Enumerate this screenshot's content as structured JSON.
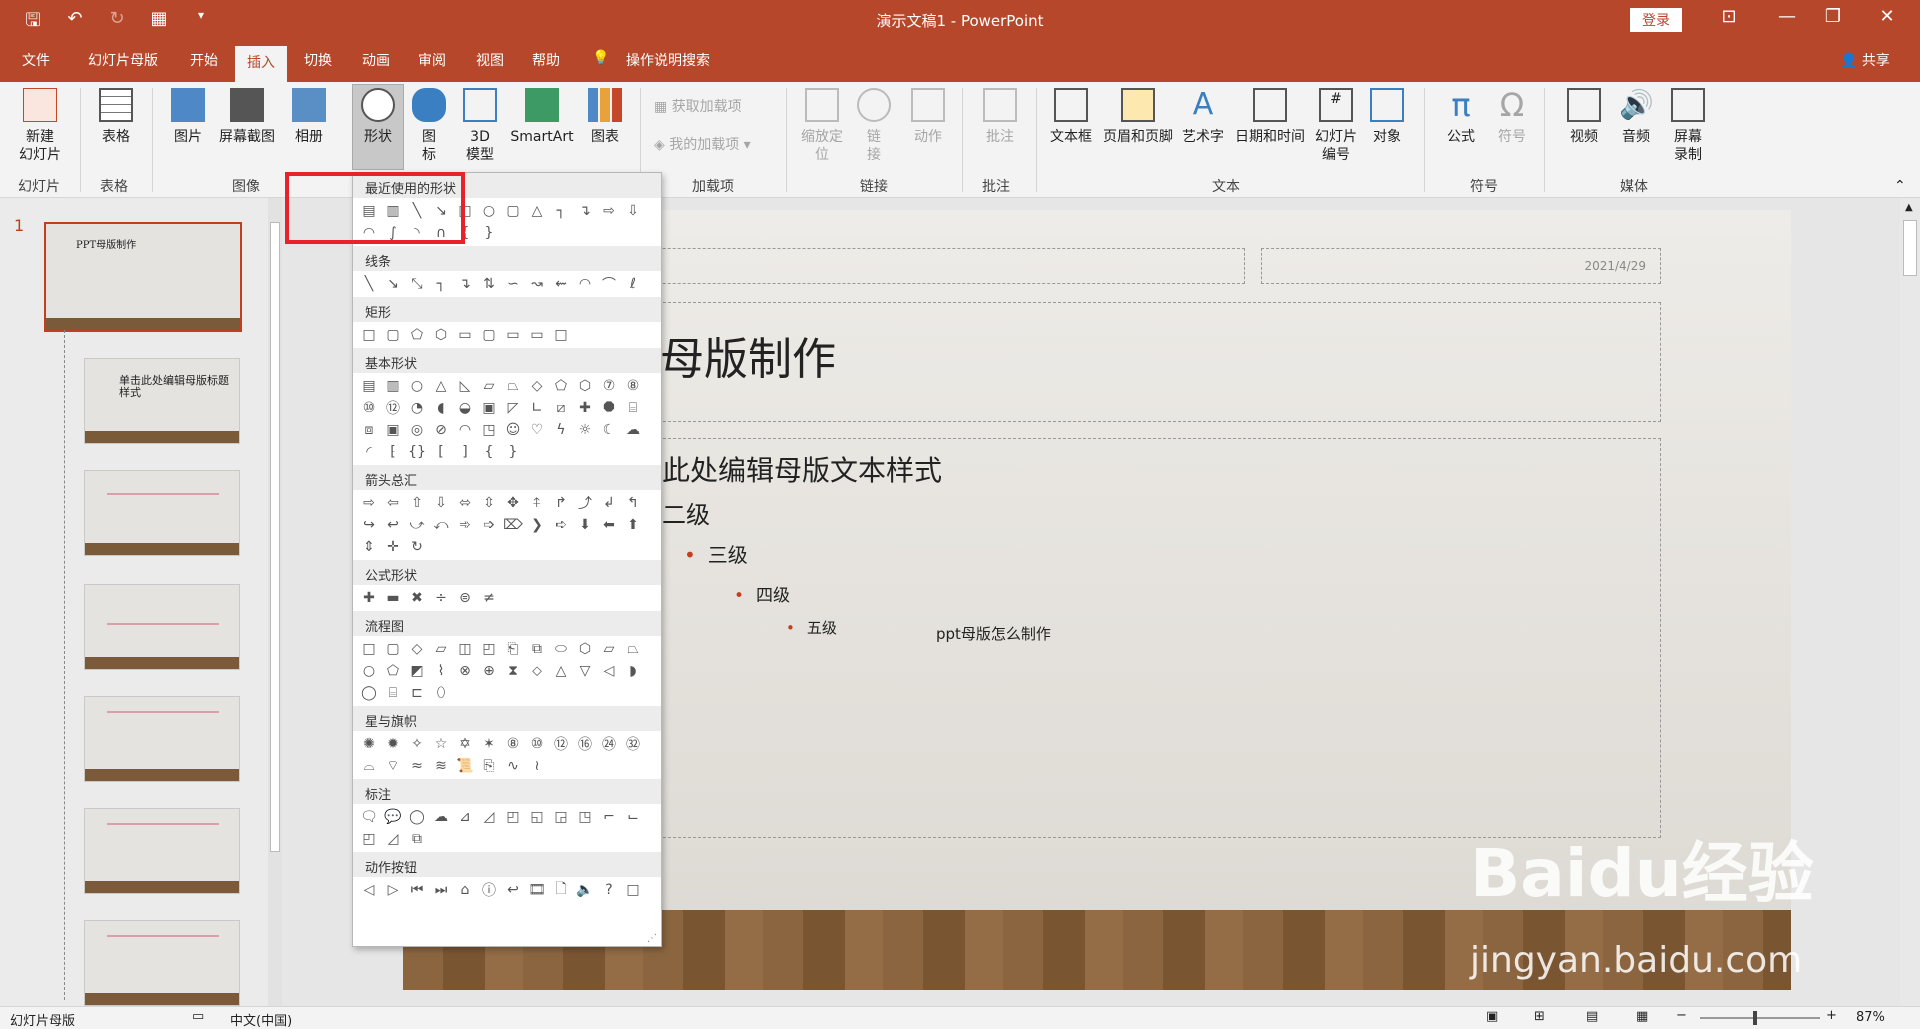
{
  "window": {
    "title": "演示文稿1 - PowerPoint",
    "login": "登录",
    "share": "共享"
  },
  "tabs": [
    "文件",
    "幻灯片母版",
    "开始",
    "插入",
    "切换",
    "动画",
    "审阅",
    "视图",
    "帮助",
    "操作说明搜索"
  ],
  "ribbon": {
    "new_slide": "新建\n幻灯片",
    "table": "表格",
    "picture": "图片",
    "screenshot": "屏幕截图",
    "album": "相册",
    "shapes": "形状",
    "icons": "图\n标",
    "model3d": "3D\n模型",
    "smartart": "SmartArt",
    "chart": "图表",
    "get_addins": "获取加载项",
    "my_addins": "我的加载项",
    "zoom": "缩放定\n位",
    "link": "链\n接",
    "action": "动作",
    "comment": "批注",
    "textbox": "文本框",
    "header_footer": "页眉和页脚",
    "wordart": "艺术字",
    "datetime": "日期和时间",
    "slide_number": "幻灯片\n编号",
    "object": "对象",
    "equation": "公式",
    "symbol": "符号",
    "video": "视频",
    "audio": "音频",
    "screen_record": "屏幕\n录制"
  },
  "groups": [
    "幻灯片",
    "表格",
    "图像",
    "加载项",
    "链接",
    "批注",
    "文本",
    "符号",
    "媒体"
  ],
  "gallery": {
    "sections": [
      "最近使用的形状",
      "线条",
      "矩形",
      "基本形状",
      "箭头总汇",
      "公式形状",
      "流程图",
      "星与旗帜",
      "标注",
      "动作按钮"
    ]
  },
  "slide": {
    "date": "2021/4/29",
    "title": "母版制作",
    "level1": "此处编辑母版文本样式",
    "level2": "二级",
    "level3": "三级",
    "level4": "四级",
    "level5": "五级",
    "note": "ppt母版怎么制作"
  },
  "thumbs": {
    "first_title": "PPT母版制作",
    "second_title": "单击此处编辑母版标题样式",
    "slide_num": "1"
  },
  "status": {
    "view": "幻灯片母版",
    "lang": "中文(中国)",
    "zoom": "87%"
  },
  "watermark": {
    "brand": "Baidu经验",
    "url": "jingyan.baidu.com"
  }
}
